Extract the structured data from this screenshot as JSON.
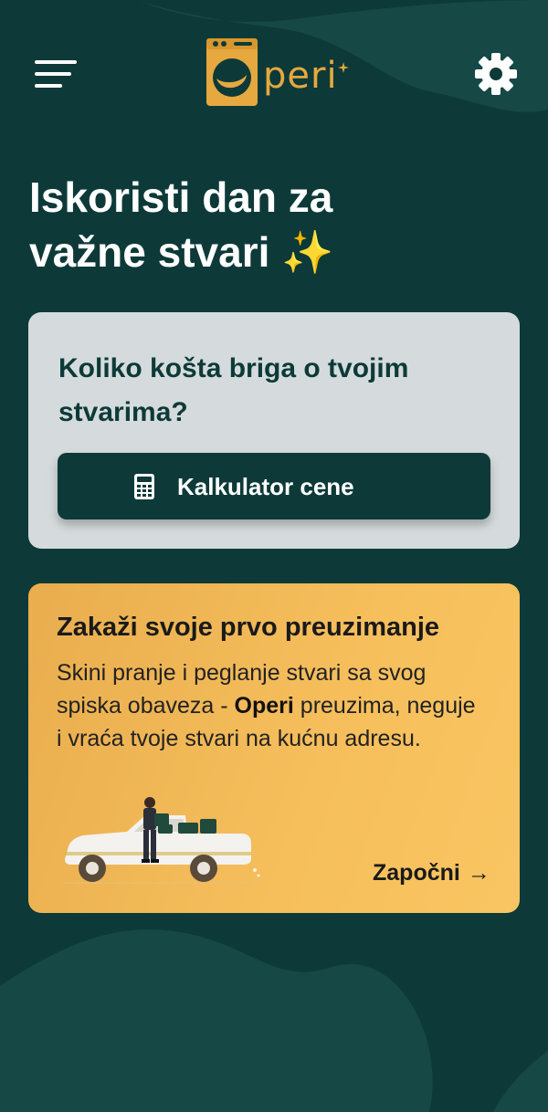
{
  "app": {
    "logo_text": "peri",
    "colors": {
      "background": "#0d3a38",
      "accent": "#e6a83f",
      "card_light": "#d5dbdc",
      "card_orange": "#f6bf5c"
    }
  },
  "header": {
    "menu_icon": "hamburger-menu-icon",
    "logo_icon": "washing-machine-logo-icon",
    "settings_icon": "gear-icon"
  },
  "hero": {
    "headline_line1": "Iskoristi dan za",
    "headline_line2": "važne stvari",
    "sparkle": "✨"
  },
  "price_card": {
    "title": "Koliko košta briga o tvojim stvarima?",
    "button_label": "Kalkulator cene",
    "button_icon": "calculator-icon"
  },
  "pickup_card": {
    "title": "Zakaži svoje prvo preuzimanje",
    "desc_before": "Skini pranje i peglanje stvari sa svog spiska obaveza - ",
    "desc_brand": "Operi",
    "desc_after": " preuzima, neguje i vraća tvoje stvari na kućnu adresu.",
    "illustration": "delivery-person-car-illustration",
    "cta_label": "Započni",
    "cta_arrow": "→"
  }
}
